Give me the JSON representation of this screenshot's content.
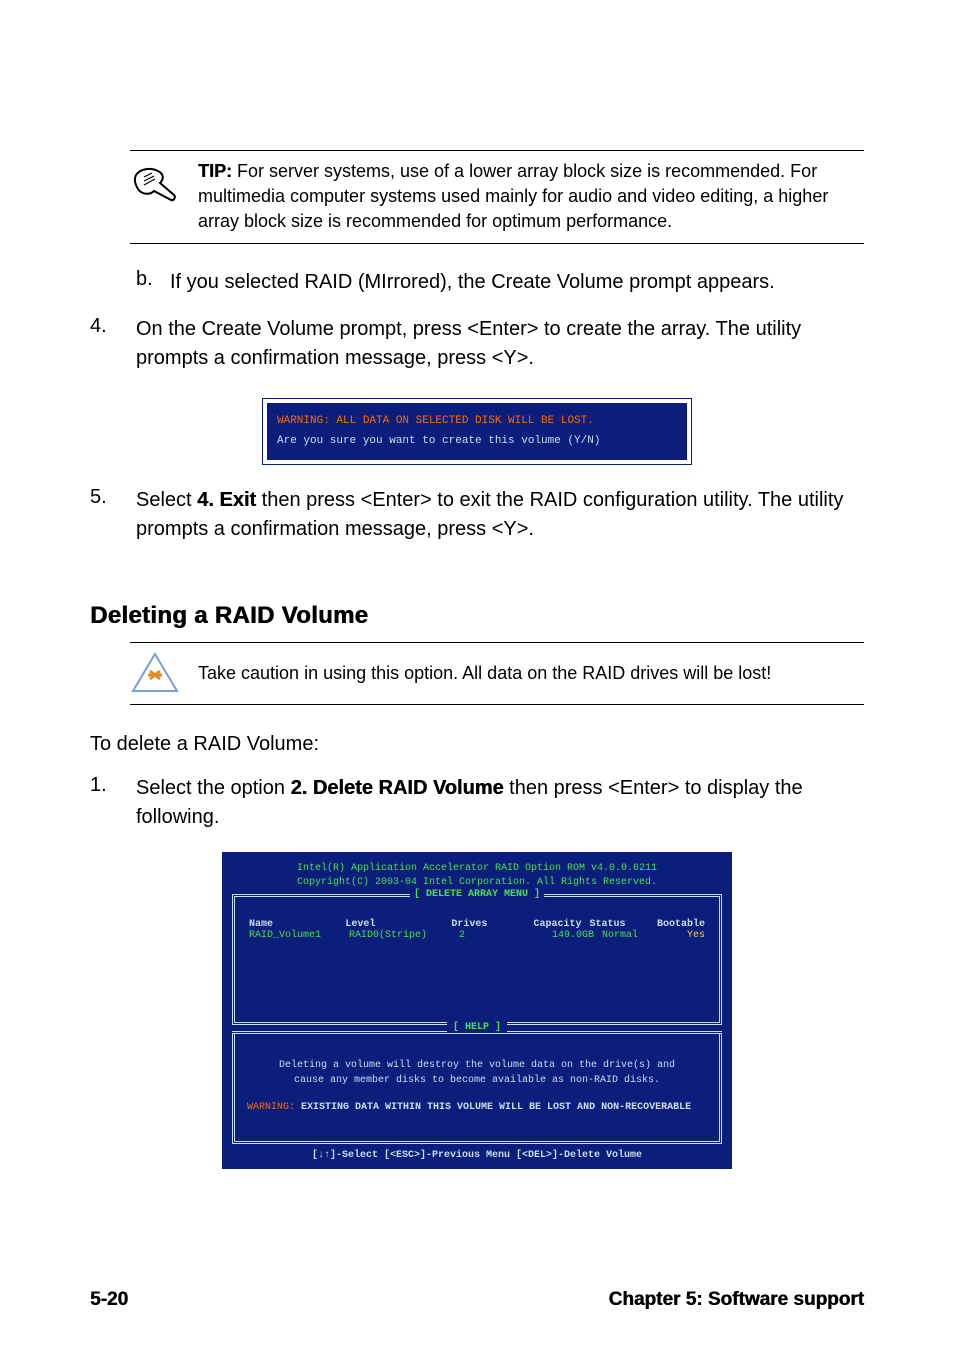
{
  "tip": {
    "label": "TIP:",
    "text": " For server systems, use of a lower array block size is recommended. For multimedia computer systems used mainly for audio and video editing, a higher array block size is recommended for optimum performance."
  },
  "step_b": {
    "letter": "b.",
    "text": "If you selected RAID (MIrrored), the Create Volume prompt appears."
  },
  "step4": {
    "num": "4.",
    "text": "On the Create Volume prompt, press <Enter> to create the array. The utility prompts a confirmation message, press <Y>."
  },
  "confirm_box": {
    "warning": "WARNING:  ALL DATA ON SELECTED DISK WILL BE LOST.",
    "prompt": "Are you sure you want to create this volume (Y/N)"
  },
  "step5": {
    "num": "5.",
    "pre": "Select ",
    "opt": "4. Exit",
    "post": " then press <Enter> to exit the RAID configuration utility. The utility prompts a confirmation message, press <Y>."
  },
  "heading": "Deleting a RAID Volume",
  "caution": "Take caution in using this option. All data on the RAID drives will be lost!",
  "intro": "To delete a RAID Volume:",
  "step1": {
    "num": "1.",
    "pre": "Select the option ",
    "opt": "2. Delete RAID Volume",
    "post": " then press <Enter> to display the following."
  },
  "bios": {
    "title1": "Intel(R) Application Accelerator RAID Option ROM v4.0.0.6211",
    "title2": "Copyright(C) 2003-04 Intel Corporation. All Rights Reserved.",
    "menu_title": "[ DELETE ARRAY MENU ]",
    "cols": {
      "name": "Name",
      "level": "Level",
      "drives": "Drives",
      "capacity": "Capacity",
      "status": "Status",
      "bootable": "Bootable"
    },
    "row": {
      "name": "RAID_Volume1",
      "level": "RAID0(Stripe)",
      "drives": "2",
      "capacity": "149.0GB",
      "status": "Normal",
      "bootable": "Yes"
    },
    "help_title": "[ HELP ]",
    "help_line1": "Deleting a volume will destroy the volume data on the drive(s) and",
    "help_line2": "cause any member disks to become available as non-RAID disks.",
    "help_warn_label": "WARNING:",
    "help_warn_text": " EXISTING DATA WITHIN THIS VOLUME WILL BE LOST AND NON-RECOVERABLE",
    "footer": "[↓↑]-Select    [<ESC>]-Previous Menu   [<DEL>]-Delete Volume"
  },
  "footer": {
    "left": "5-20",
    "right": "Chapter 5: Software support"
  }
}
